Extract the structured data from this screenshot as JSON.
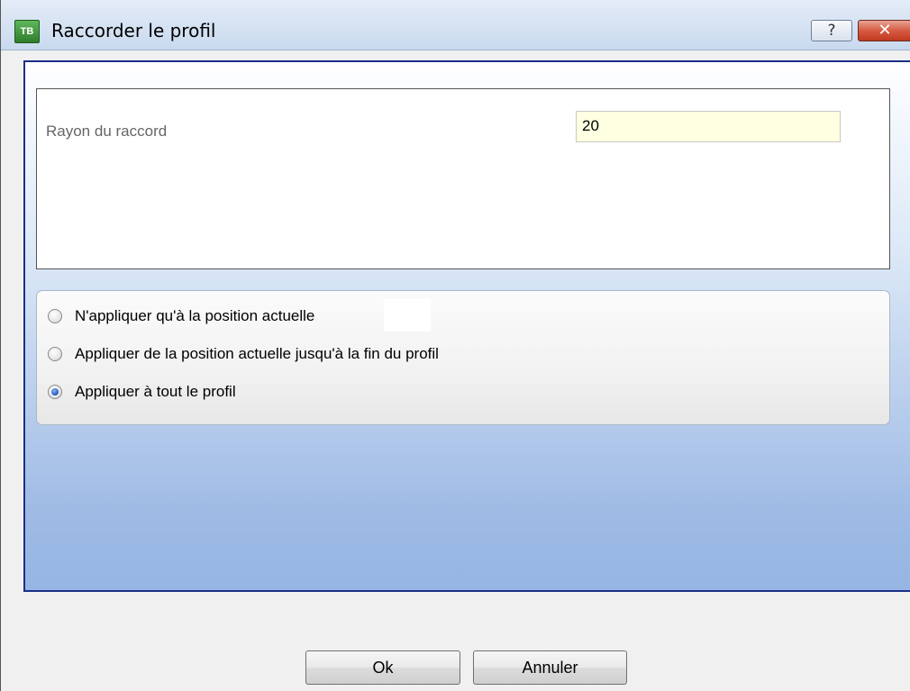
{
  "window": {
    "title": "Raccorder le profil",
    "help_symbol": "?",
    "close_symbol": "✕",
    "app_icon_text": "TB"
  },
  "parameters": {
    "radius_label": "Rayon du raccord",
    "radius_value": "20"
  },
  "options": [
    {
      "label": "N'appliquer qu'à la position actuelle",
      "checked": false
    },
    {
      "label": "Appliquer de la position actuelle jusqu'à la fin du profil",
      "checked": false
    },
    {
      "label": "Appliquer à tout le profil",
      "checked": true
    }
  ],
  "buttons": {
    "ok": "Ok",
    "cancel": "Annuler"
  },
  "colors": {
    "panel_border": "#1b2f86",
    "input_background": "#ffffe1",
    "close_button": "#c0391f"
  }
}
